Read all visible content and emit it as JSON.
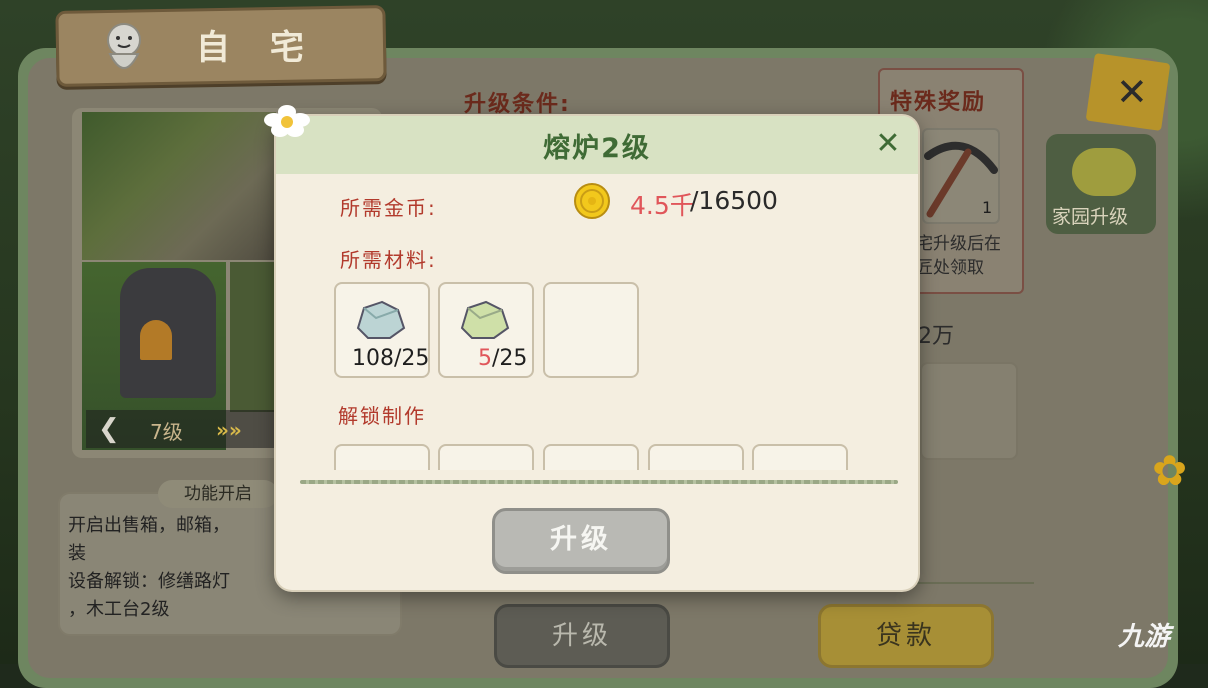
{
  "header": {
    "title": "自 宅"
  },
  "building": {
    "level_label": "7级",
    "prev_icon": "chevron-left-icon",
    "next_icon": "double-chevron-right-icon"
  },
  "function_panel": {
    "tab_label": "功能开启",
    "lines": [
      "开启出售箱，邮箱，",
      "装",
      "设备解锁：修缮路灯",
      "，木工台2级"
    ]
  },
  "upgrade_conditions_label": "升级条件:",
  "special_reward": {
    "title": "特殊奖励",
    "item_icon": "pickaxe-icon",
    "item_count": "1",
    "desc_line1": "宅升级后在",
    "desc_line2": "匠处领取"
  },
  "partial_value": "2万",
  "home_upgrade": {
    "label": "家园升级",
    "icon": "cloud-icon"
  },
  "close_icon": "close-icon",
  "bottom_buttons": {
    "upgrade": "升级",
    "loan": "贷款"
  },
  "watermark": "九游",
  "modal": {
    "title": "熔炉2级",
    "coin_label": "所需金币:",
    "coin_have": "4.5千",
    "coin_need": "/16500",
    "materials_label": "所需材料:",
    "materials": [
      {
        "icon": "stone-ore-icon",
        "have": "108",
        "need": "/25",
        "lacking": false
      },
      {
        "icon": "green-ore-icon",
        "have": "5",
        "need": "/25",
        "lacking": true
      }
    ],
    "unlock_label": "解锁制作",
    "upgrade_button": "升级",
    "colors": {
      "header_green": "#d8e2c3",
      "title_green": "#3f6b35",
      "label_red": "#b23a2c",
      "lack_red": "#e0565a"
    }
  }
}
